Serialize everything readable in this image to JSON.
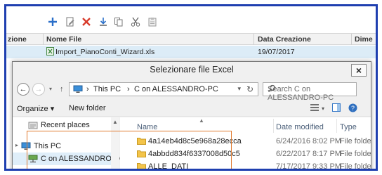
{
  "toolbar": {
    "icons": [
      "add-icon",
      "edit-icon",
      "delete-icon",
      "download-icon",
      "copy-icon",
      "cut-icon",
      "paste-icon"
    ],
    "colors": {
      "add": "#2a6fc9",
      "delete": "#d83b2b"
    }
  },
  "grid": {
    "columns": [
      "zione",
      "Nome File",
      "Data Creazione",
      "Dime"
    ],
    "rows": [
      {
        "file": "Import_PianoConti_Wizard.xls",
        "date": "19/07/2017"
      }
    ]
  },
  "dialog": {
    "title": "Selezionare file Excel",
    "close_label": "×",
    "address": {
      "segments": [
        "This PC",
        "C on ALESSANDRO-PC"
      ],
      "sep": "›"
    },
    "search_placeholder": "Search C on ALESSANDRO-PC",
    "organize_label": "Organize ▾",
    "new_folder_label": "New folder",
    "nav_items": [
      {
        "label": "Recent places",
        "icon": "recent-places-icon"
      },
      {
        "label": "This PC",
        "icon": "this-pc-icon"
      },
      {
        "label": "C on ALESSANDRO-PC",
        "icon": "network-drive-icon"
      }
    ],
    "list_columns": {
      "name": "Name",
      "date": "Date modified",
      "type": "Type"
    },
    "files": [
      {
        "name": "4a14eb4d8c5e968a28ecca",
        "date": "6/24/2016 8:02 PM",
        "type": "File folder"
      },
      {
        "name": "4abbdd834f6337008d50c5",
        "date": "6/22/2017 8:17 PM",
        "type": "File folder"
      },
      {
        "name": "ALLE_DATI",
        "date": "7/17/2017 9:33 PM",
        "type": "File folder"
      }
    ]
  },
  "accent": {
    "frame": "#1f3fb0",
    "highlight": "#e07a2f",
    "selection": "#dcecf7"
  }
}
